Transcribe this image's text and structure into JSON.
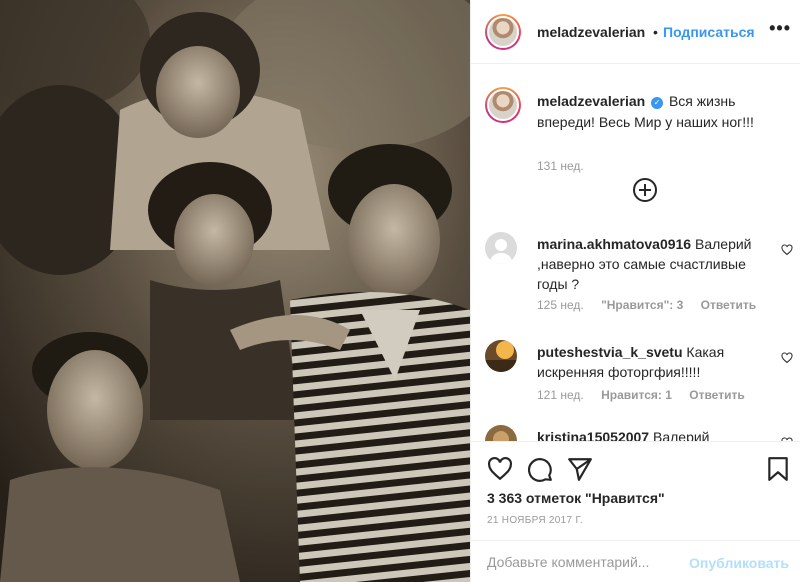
{
  "post": {
    "username": "meladzevalerian",
    "separator": "•",
    "follow_label": "Подписаться",
    "more_icon": "more-horizontal-icon",
    "caption_text": "Вся жизнь впереди! Весь Мир у наших ног!!!",
    "caption_time": "131 нед.",
    "verified_icon": "verified-badge-icon"
  },
  "comments": [
    {
      "username": "marina.akhmatova0916",
      "text": "Валерий ,наверно это самые счастливые годы ?",
      "time": "125 нед.",
      "likes_label": "\"Нравится\": 3",
      "reply_label": "Ответить"
    },
    {
      "username": "puteshestvia_k_svetu",
      "text": "Какая искренняя фоторгфия!!!!!",
      "time": "121 нед.",
      "likes_label": "Нравится: 1",
      "reply_label": "Ответить"
    },
    {
      "username": "kristina15052007",
      "text": "Валерий"
    }
  ],
  "actions": {
    "likes_text": "3 363 отметок \"Нравится\"",
    "date_text": "21 НОЯБРЯ 2017 Г.",
    "icons": [
      "heart-icon",
      "comment-icon",
      "share-icon",
      "bookmark-icon"
    ]
  },
  "add_comment": {
    "placeholder": "Добавьте комментарий...",
    "post_label": "Опубликовать"
  },
  "colors": {
    "link_blue": "#3897f0",
    "disabled_blue": "#b2dffc",
    "muted_gray": "#999999",
    "border": "#efefef"
  }
}
